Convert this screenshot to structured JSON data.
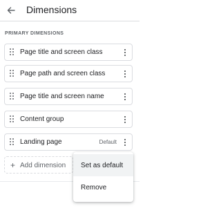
{
  "header": {
    "title": "Dimensions",
    "back_icon": "arrow-left-icon"
  },
  "section": {
    "label": "PRIMARY DIMENSIONS"
  },
  "items": [
    {
      "label": "Page title and screen class",
      "default": ""
    },
    {
      "label": "Page path and screen class",
      "default": ""
    },
    {
      "label": "Page title and screen name",
      "default": ""
    },
    {
      "label": "Content group",
      "default": ""
    },
    {
      "label": "Landing page",
      "default": "Default"
    }
  ],
  "add_button": {
    "label": "Add dimension",
    "icon": "plus-icon"
  },
  "menu": {
    "items": [
      {
        "label": "Set as default"
      },
      {
        "label": "Remove"
      }
    ]
  },
  "colors": {
    "text": "#202124",
    "secondary": "#5f6368",
    "border": "#dadce0",
    "hover": "#f1f3f4"
  }
}
